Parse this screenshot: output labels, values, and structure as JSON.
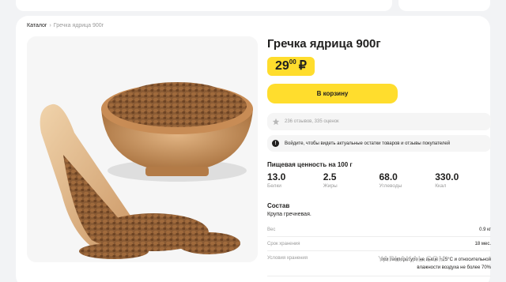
{
  "breadcrumb": {
    "root": "Каталог",
    "separator": "›",
    "current": "Гречка ядрица 900г"
  },
  "product": {
    "title": "Гречка ядрица 900г",
    "price_int": "29",
    "price_frac": "00",
    "currency": "₽",
    "cart_button": "В корзину",
    "rating_text": "236 отзывов, 335 оценок",
    "login_notice": "Войдите, чтобы видеть актуальные остатки товаров и отзывы покупателей"
  },
  "nutrition": {
    "title": "Пищевая ценность на 100 г",
    "items": [
      {
        "value": "13.0",
        "label": "Белки"
      },
      {
        "value": "2.5",
        "label": "Жиры"
      },
      {
        "value": "68.0",
        "label": "Углеводы"
      },
      {
        "value": "330.0",
        "label": "Ккал"
      }
    ]
  },
  "composition": {
    "title": "Состав",
    "text": "Крупа гречневая."
  },
  "properties": [
    {
      "key": "Вес",
      "value": "0.9 кг"
    },
    {
      "key": "Срок хранения",
      "value": "18 мес."
    },
    {
      "key": "Условия хранения",
      "value": "при температуре не выше +25°С и относительной влажности воздуха не более 70%"
    }
  ],
  "watermark": "YAPLAKAL.COM",
  "colors": {
    "accent": "#ffdd2d",
    "background": "#f2f3f5",
    "muted": "#9a9a9a",
    "text": "#21201f"
  }
}
